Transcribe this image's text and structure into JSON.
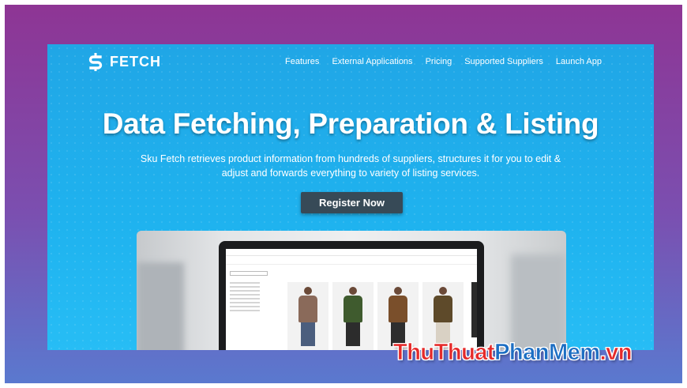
{
  "brand": {
    "name": "FETCH",
    "icon": "dollar-s-icon"
  },
  "nav": {
    "links": [
      "Features",
      "External Applications",
      "Pricing",
      "Supported Suppliers",
      "Launch App"
    ]
  },
  "hero": {
    "title": "Data Fetching, Preparation & Listing",
    "subtitle": "Sku Fetch retrieves product information from hundreds of suppliers, structures it for you to edit & adjust and forwards everything to variety of listing services.",
    "cta_label": "Register Now"
  },
  "colors": {
    "frame_top": "#8e3594",
    "frame_bottom": "#5a79cf",
    "hero_blue": "#20a6e6",
    "cta_bg": "#374a57",
    "watermark_red": "#e52a2a",
    "watermark_blue": "#1c6ec3"
  },
  "watermark": {
    "part1": "ThuThuat",
    "part2": "PhanMem",
    "part3": ".vn"
  }
}
